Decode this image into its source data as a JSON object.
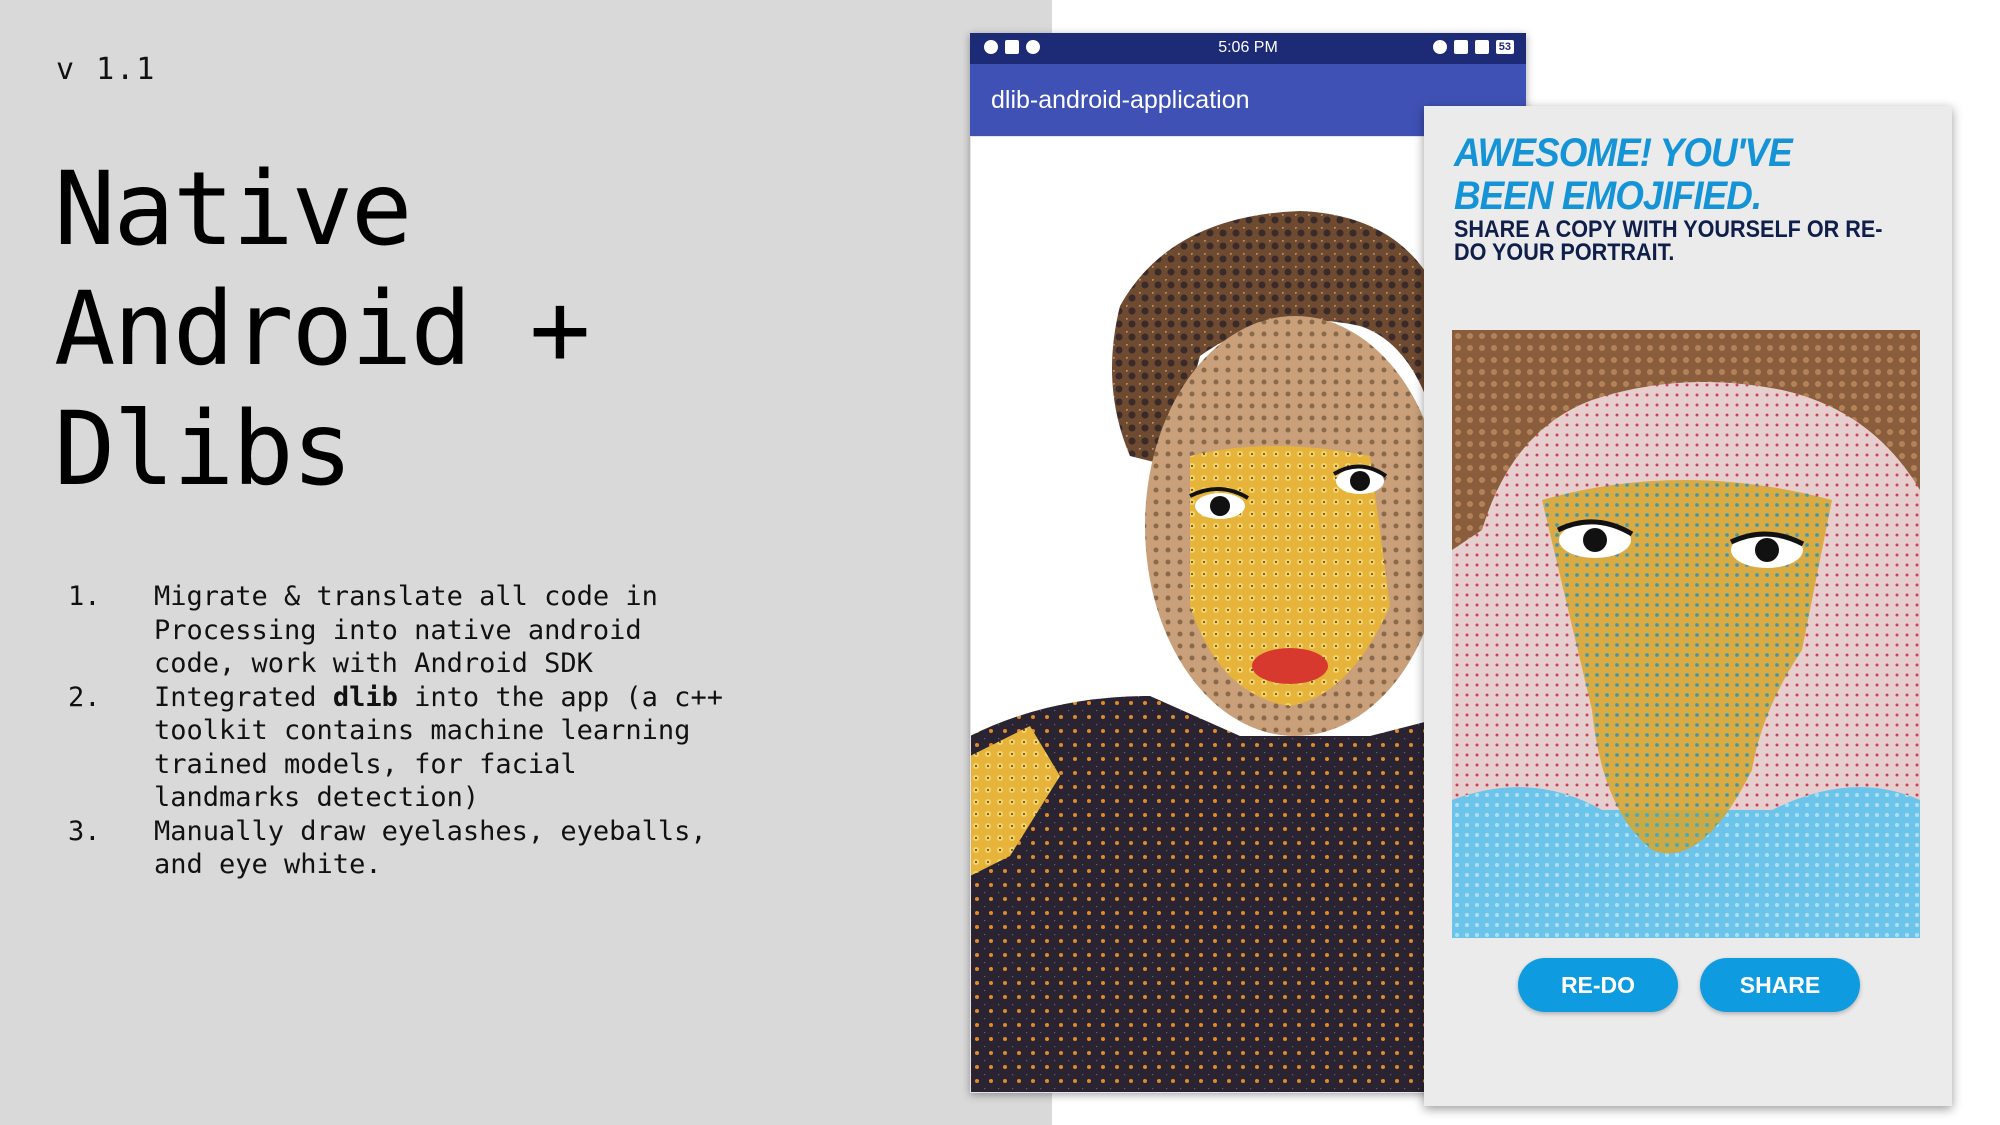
{
  "slide": {
    "version": "v 1.1",
    "title_lines": [
      "Native",
      "Android +",
      "Dlibs"
    ],
    "steps": [
      {
        "num": "1.",
        "text": "Migrate & translate all code in Processing into native android code, work with Android SDK"
      },
      {
        "num": "2.",
        "before": "Integrated ",
        "bold": "dlib",
        "after": " into the app (a c++ toolkit contains machine learning trained models, for facial landmarks detection)"
      },
      {
        "num": "3.",
        "text": "Manually draw eyelashes, eyeballs, and eye white."
      }
    ]
  },
  "phone1": {
    "status_time": "5:06 PM",
    "battery": "53",
    "app_title": "dlib-android-application"
  },
  "phone2": {
    "headline": "AWESOME! YOU'VE BEEN EMOJIFIED.",
    "subline": "SHARE A COPY WITH YOURSELF OR RE-DO YOUR PORTRAIT.",
    "redo_label": "RE-DO",
    "share_label": "SHARE"
  },
  "colors": {
    "statusbar": "#1d2a75",
    "appbar": "#3f51b5",
    "accent_blue": "#0e9be0",
    "headline_blue": "#1494d6",
    "slide_bg": "#d9d9d9"
  }
}
